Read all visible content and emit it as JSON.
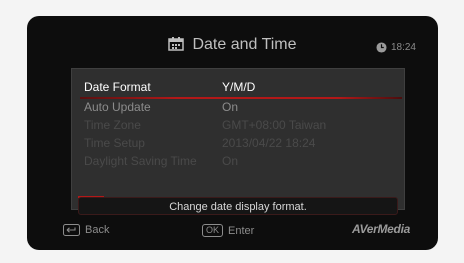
{
  "header": {
    "title": "Date and Time",
    "time": "18:24"
  },
  "settings": [
    {
      "label": "Date Format",
      "value": "Y/M/D",
      "state": "active"
    },
    {
      "label": "Auto Update",
      "value": "On",
      "state": "enabled"
    },
    {
      "label": "Time Zone",
      "value": "GMT+08:00 Taiwan",
      "state": "disabled"
    },
    {
      "label": "Time Setup",
      "value": "2013/04/22 18:24",
      "state": "disabled"
    },
    {
      "label": "Daylight Saving Time",
      "value": "On",
      "state": "disabled"
    }
  ],
  "help_text": "Change date display format.",
  "footer": {
    "back_label": "Back",
    "enter_key": "OK",
    "enter_label": "Enter",
    "brand": "AVerMedia"
  },
  "colors": {
    "accent": "#b31818",
    "screen_bg": "#0d0d0d",
    "panel_bg": "#2f2f2f"
  }
}
